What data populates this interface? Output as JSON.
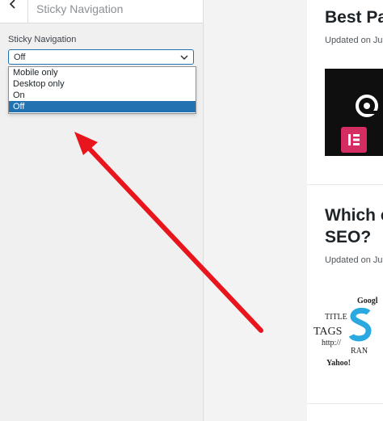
{
  "panel": {
    "title": "Sticky Navigation",
    "field_label": "Sticky Navigation",
    "select_value": "Off",
    "options": [
      {
        "label": "Mobile only",
        "selected": false
      },
      {
        "label": "Desktop only",
        "selected": false
      },
      {
        "label": "On",
        "selected": false
      },
      {
        "label": "Off",
        "selected": true
      }
    ]
  },
  "preview": {
    "post1": {
      "title": "Best Pa",
      "meta": "Updated on Jur"
    },
    "post2": {
      "title_line1": "Which c",
      "title_line2": "SEO?",
      "meta": "Updated on Jur"
    },
    "seo_words": [
      "Googl",
      "TITLE",
      "TAGS",
      "http://",
      "RAN",
      "Yahoo!"
    ]
  },
  "colors": {
    "accent": "#2271b1",
    "arrow": "#e8161c",
    "elementor": "#d42d61",
    "seo_blue": "#2aa9e0"
  }
}
